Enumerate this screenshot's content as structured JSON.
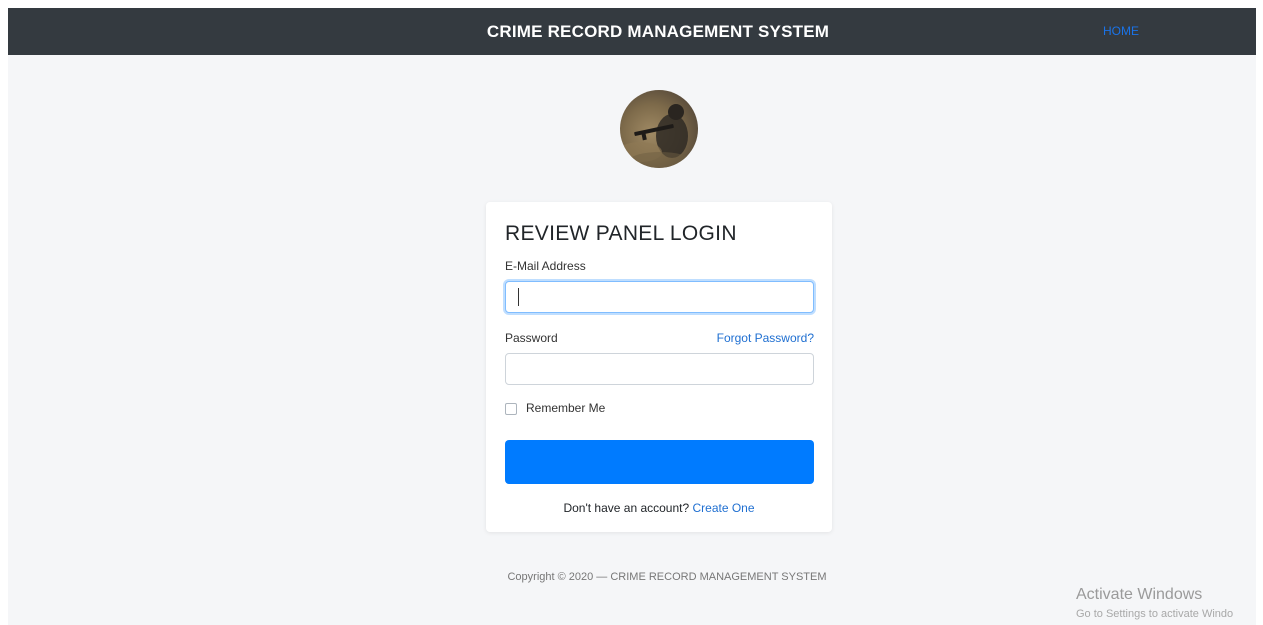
{
  "navbar": {
    "brand": "CRIME RECORD MANAGEMENT SYSTEM",
    "home_link": "HOME"
  },
  "login": {
    "title": "REVIEW PANEL LOGIN",
    "email_label": "E-Mail Address",
    "email_value": "",
    "password_label": "Password",
    "password_value": "",
    "forgot_link": "Forgot Password?",
    "remember_label": "Remember Me",
    "remember_checked": false,
    "login_button_label": "",
    "signup_prompt": "Don't have an account?",
    "signup_link": "Create One"
  },
  "footer": {
    "copyright": "Copyright © 2020 — CRIME RECORD MANAGEMENT SYSTEM"
  },
  "os_watermark": {
    "title": "Activate Windows",
    "subtitle": "Go to Settings to activate Windo"
  },
  "colors": {
    "navbar_bg": "#343a40",
    "primary": "#007bff",
    "link": "#1f6fd1",
    "page_bg": "#f5f6f8"
  }
}
